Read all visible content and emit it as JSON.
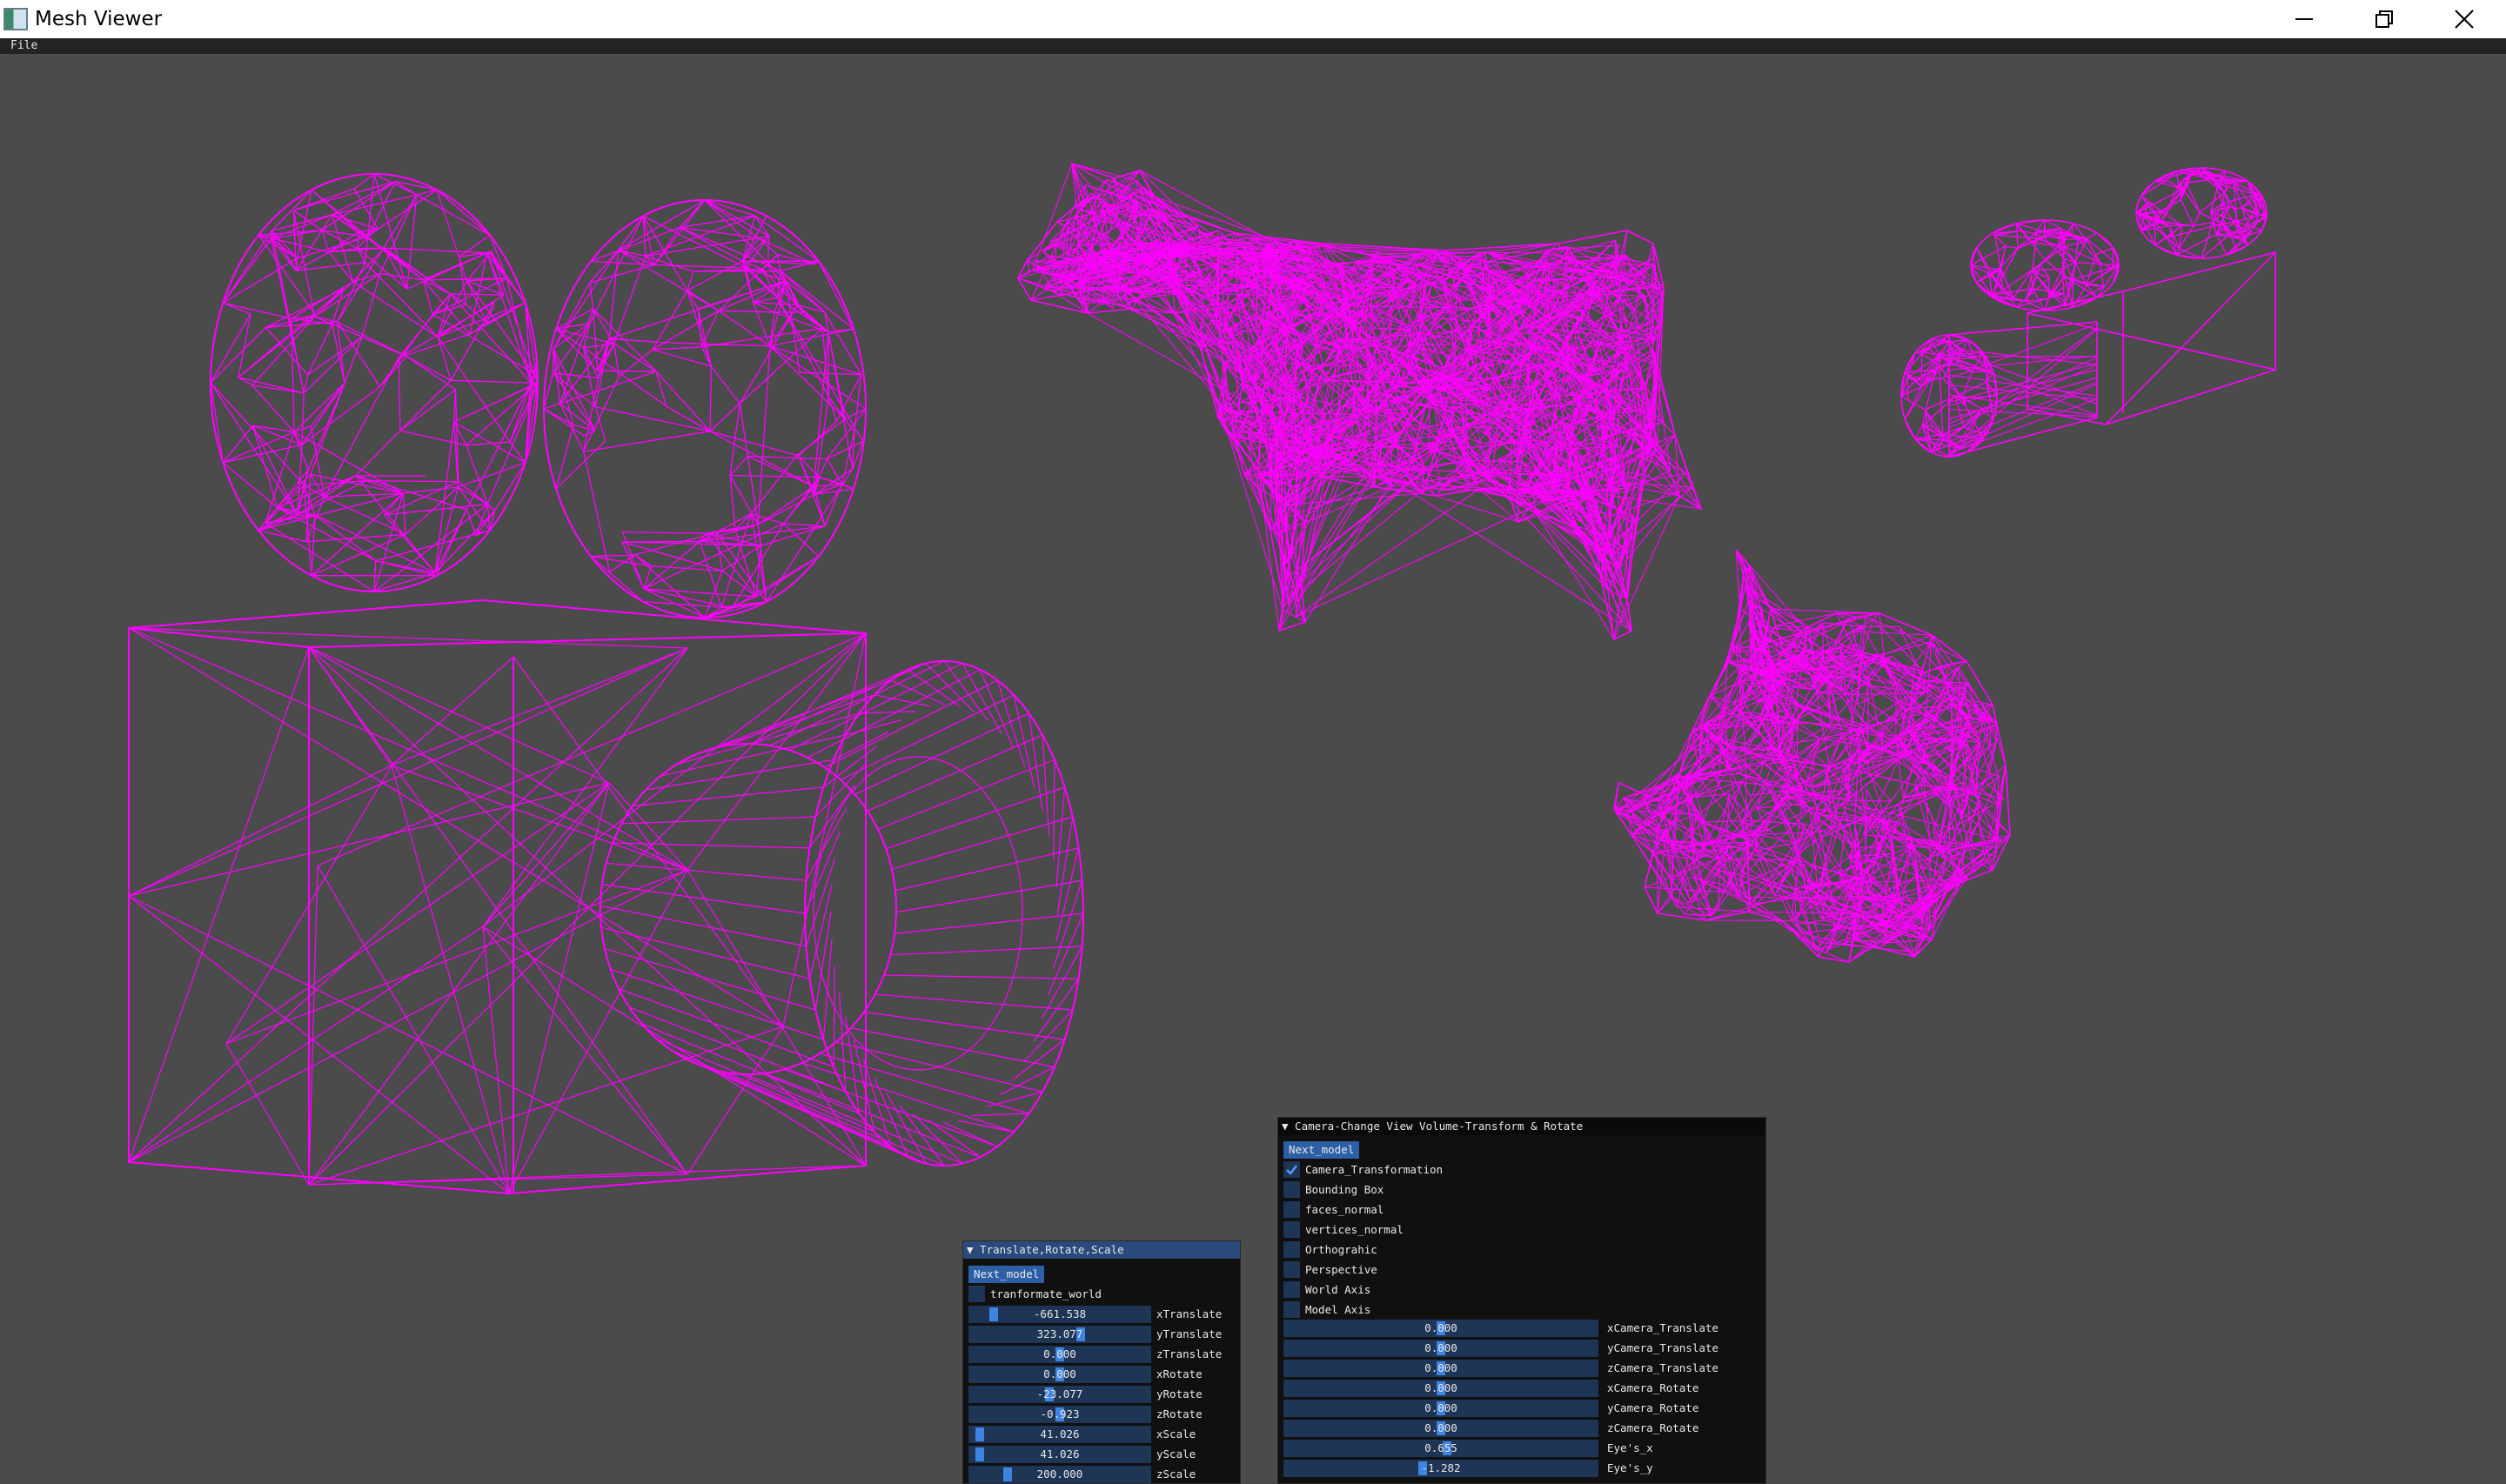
{
  "window": {
    "title": "Mesh Viewer"
  },
  "menu": {
    "file": "File"
  },
  "mesh_color": "#ff00ff",
  "background_color": "#4b4b4b",
  "icons": [
    "app-icon",
    "minimize-icon",
    "restore-icon",
    "close-icon",
    "checkmark-icon",
    "collapse-arrow-icon"
  ],
  "panel_trs": {
    "title": "▼ Translate,Rotate,Scale",
    "next_button": "Next_model",
    "checkbox": {
      "label": "tranformate_world",
      "checked": false
    },
    "sliders": [
      {
        "value": "-661.538",
        "label": "xTranslate",
        "level": 0.12
      },
      {
        "value": "323.077",
        "label": "yTranslate",
        "level": 0.62
      },
      {
        "value": "0.000",
        "label": "zTranslate",
        "level": 0.5
      },
      {
        "value": "0.000",
        "label": "xRotate",
        "level": 0.5
      },
      {
        "value": "-23.077",
        "label": "yRotate",
        "level": 0.44
      },
      {
        "value": "-0.923",
        "label": "zRotate",
        "level": 0.5
      },
      {
        "value": "41.026",
        "label": "xScale",
        "level": 0.04
      },
      {
        "value": "41.026",
        "label": "yScale",
        "level": 0.04
      },
      {
        "value": "200.000",
        "label": "zScale",
        "level": 0.2
      }
    ]
  },
  "panel_camera": {
    "title": "▼ Camera-Change View Volume-Transform & Rotate",
    "next_button": "Next_model",
    "checkboxes": [
      {
        "label": "Camera_Transformation",
        "checked": true
      },
      {
        "label": "Bounding Box",
        "checked": false
      },
      {
        "label": "faces_normal",
        "checked": false
      },
      {
        "label": "vertices_normal",
        "checked": false
      },
      {
        "label": "Orthograhic",
        "checked": false
      },
      {
        "label": "Perspective",
        "checked": false
      },
      {
        "label": "World Axis",
        "checked": false
      },
      {
        "label": "Model Axis",
        "checked": false
      }
    ],
    "sliders": [
      {
        "value": "0.000",
        "label": "xCamera_Translate",
        "level": 0.5
      },
      {
        "value": "0.000",
        "label": "yCamera_Translate",
        "level": 0.5
      },
      {
        "value": "0.000",
        "label": "zCamera_Translate",
        "level": 0.5
      },
      {
        "value": "0.000",
        "label": "xCamera_Rotate",
        "level": 0.5
      },
      {
        "value": "0.000",
        "label": "yCamera_Rotate",
        "level": 0.5
      },
      {
        "value": "0.000",
        "label": "zCamera_Rotate",
        "level": 0.5
      },
      {
        "value": "0.655",
        "label": "Eye's_x",
        "level": 0.52
      },
      {
        "value": "-1.282",
        "label": "Eye's_y",
        "level": 0.44
      }
    ]
  }
}
